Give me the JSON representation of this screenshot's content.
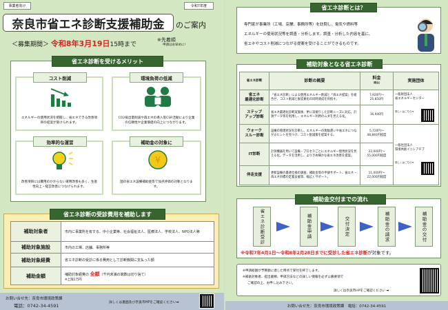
{
  "left": {
    "tag": "事業者向け",
    "year": "令和7年度",
    "title": "奈良市省エネ診断支援補助金",
    "title_suffix": "のご案内",
    "period_label": "＜募集期間＞",
    "period_date": "令和8年3月19日",
    "period_time": "15時まで",
    "first_come": "※先着順",
    "apply_early": "申請はお早めに!",
    "merit_header": "省エネ診断を受けるメリット",
    "merits": [
      {
        "title": "コスト削減",
        "icon": "chart-down-icon",
        "desc": "エネルギーの使用状況を把握し、省エネできる改善項目の提案が受けられます。"
      },
      {
        "title": "環境負荷の低減",
        "icon": "people-icon",
        "desc": "CO2排出量削減や再エネの導入等CSR活動により企業の信頼性や企業価値の向上につながります。"
      },
      {
        "title": "効率的な運営",
        "icon": "lightbulb-icon",
        "desc": "改善項目には費用のかからない運用改善も多く、生産性向上・経営改善につなげられます。"
      },
      {
        "title": "補助金の対象に",
        "icon": "yen-coin-icon",
        "desc": "国の省エネ設備補助金等で加点評価の対象となります。"
      }
    ],
    "subsidy_header": "省エネ診断の受診費用を補助します",
    "subsidy_rows": [
      {
        "label": "補助対象者",
        "value": "市内に事業所を有する、中小企業等、社会福祉法人、医療法人、学校法人、NPO法人等"
      },
      {
        "label": "補助対象施設",
        "value": "市内の工場、店舗、事務所等"
      },
      {
        "label": "補助対象経費",
        "value": "省エネ診断の受診に係る費用として診断機関に支払った額"
      },
      {
        "label": "補助金額",
        "value_pre": "補助対象経費の",
        "value_em": "全額",
        "value_post": "（千円未満の端数は切り捨て）",
        "note": "※上限2万円"
      }
    ],
    "footer_contact": "お問い合せ先：奈良市環境政策課",
    "footer_tel": "電話：0742-34-4591",
    "footer_more": "詳しくは裏面及び奈良市HPをご確認ください➡"
  },
  "right": {
    "about_header": "省エネ診断とは？",
    "about_lines": [
      "専門家が事業所（工場、店舗、事務所等）を訪問し、電気や燃料等",
      "エネルギーの使用状況等を調査・分析します。調査・分析した内容を基に、",
      "省エネやコスト削減につながる提案を受けることができるものです。"
    ],
    "target_header": "補助対象となる省エネ診断",
    "table_headers": [
      "省エネ診断",
      "診断の概要",
      "料金",
      "（税込）",
      "実施団体"
    ],
    "rows": [
      {
        "name": "省エネ\n最適化診断",
        "desc": "「省エネ診断」による使用エネルギー削減と「再エネ提案」を組合せ、コスト削減と脱炭素化の同時達成を目指す。",
        "price": "7,920円～\n25,850円"
      },
      {
        "name": "ステップ\nアップ診断",
        "desc": "省エネ最適化診断実施後、更に深掘りした診断ニーズに対応。計測データ等を利用し、エネルギー利用のムダを見える化。",
        "price": "16,940円"
      },
      {
        "name": "ウォーク\nスルー診断",
        "desc": "設備の管理状況を診断し、エネルギーの無駄遣いや省エネにつながるヒントを見つけ、コスト削減策を提案する。",
        "price": "5,720円～\n48,840円程度"
      },
      {
        "name": "IT診断",
        "desc": "計測機器を用いて設備・プロセスごとにエネルギー使用状況を見える化。データを活用し、よりきめ細かな省エネ改善を提案。",
        "price": "22,000円～\n55,000円程度"
      },
      {
        "name": "伴走支援",
        "desc": "更新設備の最適仕様の調査、補助金等の申請サポート、省エネ・再エネ目標の定着支援等、幅広くサポート。",
        "price": "11,000円～\n22,000円程度"
      }
    ],
    "orgs": [
      {
        "name": "一般財団法人\n省エネルギーセンター",
        "more": "詳しくはこちら➡"
      },
      {
        "name": "一般社団法人\n環境共創イニシアチブ",
        "more": "詳しくはこちら➡"
      }
    ],
    "flow_header": "補助金交付までの流れ",
    "steps": [
      "省エネ診断受診",
      "補助金申請",
      "交付決定",
      "補助金の請求",
      "補助金の交付"
    ],
    "flow_note_red": "※令和7年4月1日～令和8年2月28日までに受診した省エネ診断",
    "flow_note_black": "が対象です。",
    "notes": [
      "※申請総額が予算額に達した時点で受付を終了します。",
      "※補助対象者、提出書類、申請方法などの詳しい情報を必ず公募要領で",
      "ご確認の上、お申し込み下さい。"
    ],
    "notes_more": "詳しくは奈良市HPをご確認ください ➡",
    "footer": "お問い合せ先：奈良市環境政策課　電話：0742-34-4591"
  },
  "colors": {
    "bar": "#36652f",
    "bg": "#d3e8c2",
    "red": "#e02020",
    "arrow": "#3d63c4",
    "footer": "#b7c3d3"
  }
}
